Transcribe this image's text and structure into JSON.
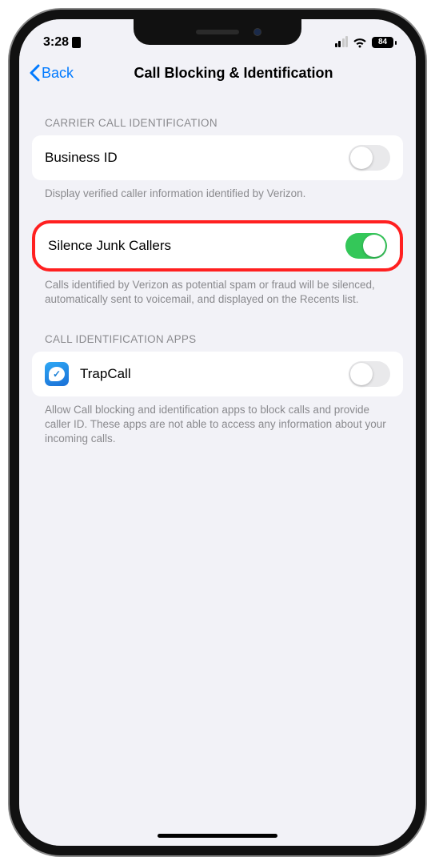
{
  "status": {
    "time": "3:28",
    "battery": "84"
  },
  "nav": {
    "back": "Back",
    "title": "Call Blocking & Identification"
  },
  "section1": {
    "header": "CARRIER CALL IDENTIFICATION",
    "row1_label": "Business ID",
    "footer1": "Display verified caller information identified by Verizon.",
    "row2_label": "Silence Junk Callers",
    "footer2": "Calls identified by Verizon as potential spam or fraud will be silenced, automatically sent to voicemail, and displayed on the Recents list."
  },
  "section2": {
    "header": "CALL IDENTIFICATION APPS",
    "row1_label": "TrapCall",
    "footer1": "Allow Call blocking and identification apps to block calls and provide caller ID. These apps are not able to access any information about your incoming calls."
  }
}
